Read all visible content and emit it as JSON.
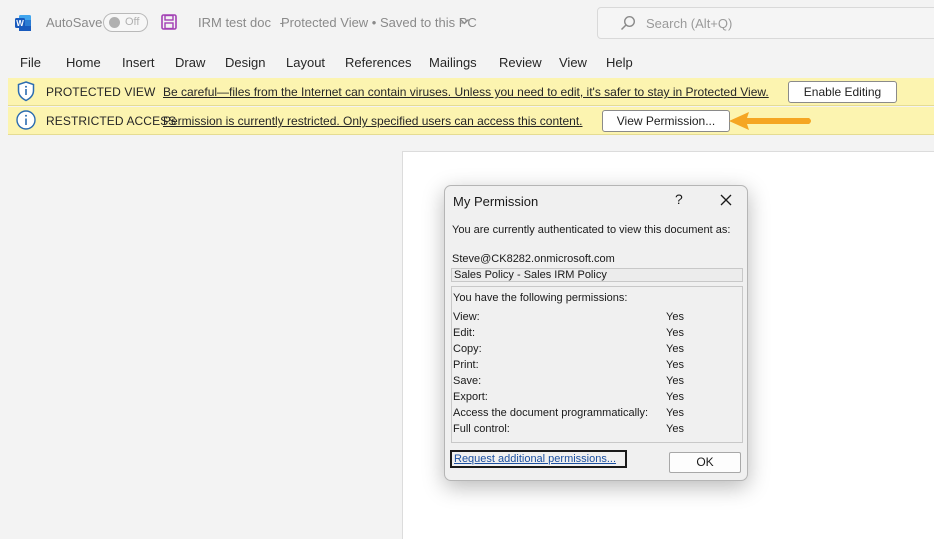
{
  "titlebar": {
    "autosave_label": "AutoSave",
    "autosave_state": "Off",
    "doc_title": "IRM test doc",
    "doc_separator": "-",
    "doc_status": "Protected View • Saved to this PC",
    "search_placeholder": "Search (Alt+Q)"
  },
  "ribbon": {
    "tabs": [
      "File",
      "Home",
      "Insert",
      "Draw",
      "Design",
      "Layout",
      "References",
      "Mailings",
      "Review",
      "View",
      "Help"
    ]
  },
  "bars": {
    "protected": {
      "title": "PROTECTED VIEW",
      "message": "Be careful—files from the Internet can contain viruses. Unless you need to edit, it's safer to stay in Protected View.",
      "button": "Enable Editing"
    },
    "restricted": {
      "title": "RESTRICTED ACCESS",
      "message": "Permission is currently restricted. Only specified users can access this content.",
      "button": "View Permission..."
    }
  },
  "dialog": {
    "title": "My Permission",
    "help": "?",
    "intro": "You are currently authenticated to view this document as:",
    "user": "Steve@CK8282.onmicrosoft.com",
    "policy": "Sales Policy - Sales IRM Policy",
    "perms_header": "You have the following permissions:",
    "permissions": [
      {
        "name": "View:",
        "value": "Yes"
      },
      {
        "name": "Edit:",
        "value": "Yes"
      },
      {
        "name": "Copy:",
        "value": "Yes"
      },
      {
        "name": "Print:",
        "value": "Yes"
      },
      {
        "name": "Save:",
        "value": "Yes"
      },
      {
        "name": "Export:",
        "value": "Yes"
      },
      {
        "name": "Access the document programmatically:",
        "value": "Yes"
      },
      {
        "name": "Full control:",
        "value": "Yes"
      }
    ],
    "request_link": "Request additional permissions...",
    "ok": "OK"
  },
  "colors": {
    "word_blue": "#185abd",
    "save_purple": "#a23fb4",
    "message_bar": "#fcf4b0",
    "info_icon": "#2b6cb0",
    "arrow": "#f5a623",
    "link": "#1a4fa0"
  },
  "icons": {
    "app": "word-logo-icon",
    "save": "save-icon",
    "search": "search-icon",
    "shield": "shield-info-icon",
    "info": "info-circle-icon",
    "arrow": "arrow-left-icon",
    "close": "close-icon"
  }
}
